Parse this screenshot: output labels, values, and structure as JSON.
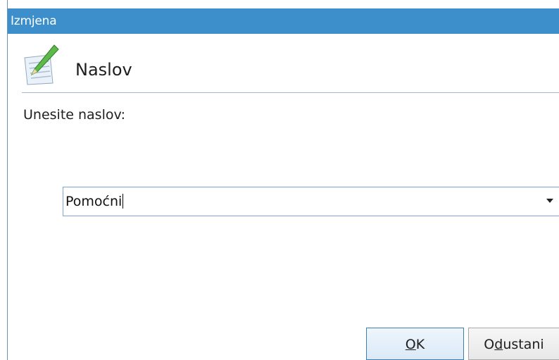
{
  "window": {
    "title": "Izmjena"
  },
  "header": {
    "title": "Naslov",
    "icon": "edit-document-icon"
  },
  "prompt": {
    "label": "Unesite naslov:"
  },
  "combo": {
    "value": "Pomoćni",
    "arrow_icon": "dropdown-arrow-icon"
  },
  "buttons": {
    "ok": {
      "accel": "O",
      "rest": "K"
    },
    "cancel": {
      "pre": "O",
      "accel": "d",
      "rest": "ustani"
    }
  },
  "colors": {
    "titlebar": "#3d8fcb",
    "separator": "#9bb9d3",
    "focus_border": "#7ba7d6"
  }
}
